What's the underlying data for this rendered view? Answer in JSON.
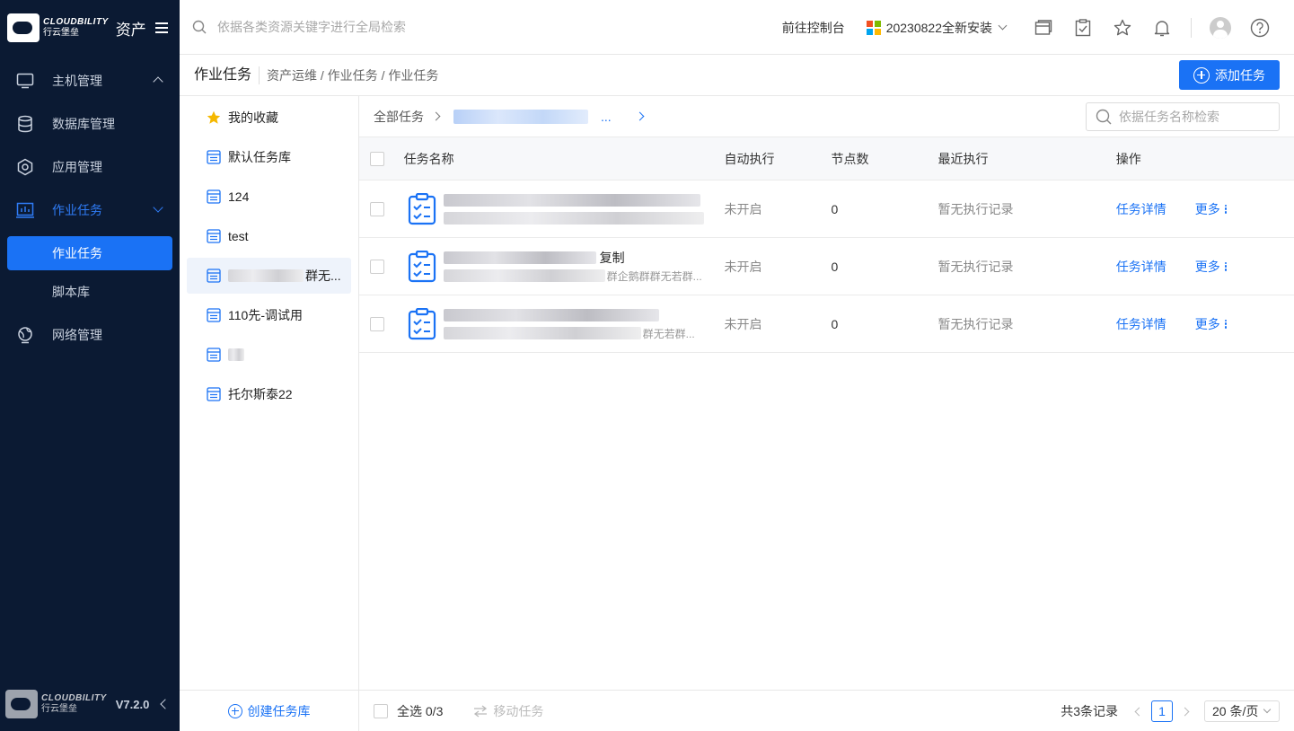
{
  "brand": {
    "name_en": "CLOUDBILITY",
    "name_cn": "行云堡垒",
    "module": "资产"
  },
  "sidebar": {
    "items": [
      {
        "label": "主机管理",
        "icon": "monitor-icon",
        "expanded": true
      },
      {
        "label": "数据库管理",
        "icon": "database-icon"
      },
      {
        "label": "应用管理",
        "icon": "hexagon-app-icon"
      },
      {
        "label": "作业任务",
        "icon": "chart-task-icon",
        "active": true,
        "expanded": true
      }
    ],
    "sub_items": [
      {
        "label": "作业任务",
        "active": true
      },
      {
        "label": "脚本库"
      }
    ],
    "network_item": {
      "label": "网络管理",
      "icon": "globe-icon"
    },
    "version": "V7.2.0"
  },
  "topbar": {
    "search_placeholder": "依据各类资源关键字进行全局检索",
    "console_link": "前往控制台",
    "tenant": "20230822全新安装",
    "icons": [
      "window-icon",
      "clipboard-check-icon",
      "star-icon",
      "bell-icon",
      "avatar",
      "help-icon"
    ]
  },
  "page": {
    "title": "作业任务",
    "breadcrumb": "资产运维 / 作业任务 / 作业任务",
    "add_button": "添加任务"
  },
  "libraries": {
    "items": [
      {
        "label": "我的收藏",
        "icon": "star-icon"
      },
      {
        "label": "默认任务库",
        "icon": "list-icon"
      },
      {
        "label": "124",
        "icon": "list-icon"
      },
      {
        "label": "test",
        "icon": "list-icon"
      },
      {
        "label": "群无...",
        "icon": "list-icon",
        "selected": true,
        "redacted": true
      },
      {
        "label": "110先-调试用",
        "icon": "list-icon"
      },
      {
        "label": "",
        "icon": "list-icon",
        "redacted": true
      },
      {
        "label": "托尔斯泰22",
        "icon": "list-icon"
      }
    ],
    "create_label": "创建任务库"
  },
  "tasks": {
    "crumb_root": "全部任务",
    "crumb_more": "...",
    "search_placeholder": "依据任务名称检索",
    "columns": [
      "任务名称",
      "自动执行",
      "节点数",
      "最近执行",
      "操作"
    ],
    "rows": [
      {
        "name_suffix": "",
        "desc_suffix": "",
        "auto": "未开启",
        "nodes": "0",
        "last": "暂无执行记录",
        "detail": "任务详情",
        "more": "更多"
      },
      {
        "name_suffix": "复制",
        "desc_suffix": "群企鹅群群无若群...",
        "auto": "未开启",
        "nodes": "0",
        "last": "暂无执行记录",
        "detail": "任务详情",
        "more": "更多"
      },
      {
        "name_suffix": "",
        "desc_suffix": "群无若群...",
        "auto": "未开启",
        "nodes": "0",
        "last": "暂无执行记录",
        "detail": "任务详情",
        "more": "更多"
      }
    ]
  },
  "footer": {
    "select_all": "全选 0/3",
    "move_task": "移动任务",
    "total": "共3条记录",
    "current_page": "1",
    "page_size": "20 条/页"
  },
  "colors": {
    "sidebar_bg": "#0b1a33",
    "accent": "#1a72f5"
  }
}
